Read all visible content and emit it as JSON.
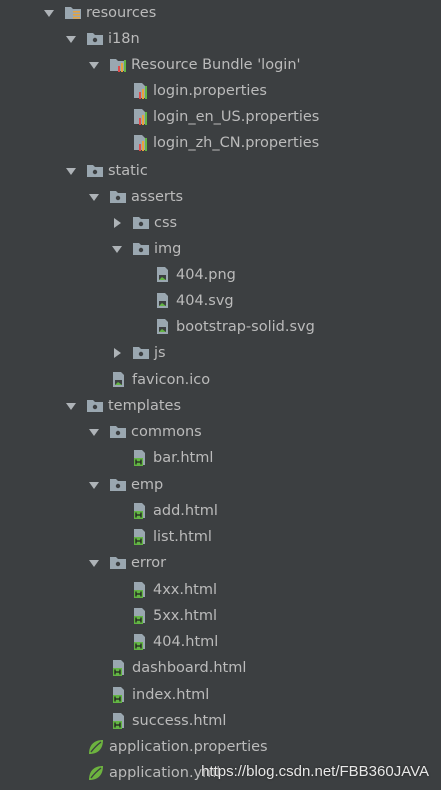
{
  "tree": [
    {
      "label": "resources",
      "icon": "resources-folder-icon",
      "expanded": true
    },
    {
      "label": "i18n",
      "icon": "folder-icon",
      "expanded": true
    },
    {
      "label": "Resource Bundle 'login'",
      "icon": "resource-bundle-icon",
      "expanded": true
    },
    {
      "label": "login.properties",
      "icon": "properties-file-icon"
    },
    {
      "label": "login_en_US.properties",
      "icon": "properties-file-icon"
    },
    {
      "label": "login_zh_CN.properties",
      "icon": "properties-file-icon"
    },
    {
      "label": "static",
      "icon": "folder-icon",
      "expanded": true
    },
    {
      "label": "asserts",
      "icon": "folder-icon",
      "expanded": true
    },
    {
      "label": "css",
      "icon": "folder-icon",
      "expanded": false
    },
    {
      "label": "img",
      "icon": "folder-icon",
      "expanded": true
    },
    {
      "label": "404.png",
      "icon": "image-file-icon"
    },
    {
      "label": "404.svg",
      "icon": "image-file-icon"
    },
    {
      "label": "bootstrap-solid.svg",
      "icon": "image-file-icon"
    },
    {
      "label": "js",
      "icon": "folder-icon",
      "expanded": false
    },
    {
      "label": "favicon.ico",
      "icon": "image-file-icon"
    },
    {
      "label": "templates",
      "icon": "folder-icon",
      "expanded": true
    },
    {
      "label": "commons",
      "icon": "folder-icon",
      "expanded": true
    },
    {
      "label": "bar.html",
      "icon": "html-file-icon"
    },
    {
      "label": "emp",
      "icon": "folder-icon",
      "expanded": true
    },
    {
      "label": "add.html",
      "icon": "html-file-icon"
    },
    {
      "label": "list.html",
      "icon": "html-file-icon"
    },
    {
      "label": "error",
      "icon": "folder-icon",
      "expanded": true
    },
    {
      "label": "4xx.html",
      "icon": "html-file-icon"
    },
    {
      "label": "5xx.html",
      "icon": "html-file-icon"
    },
    {
      "label": "404.html",
      "icon": "html-file-icon"
    },
    {
      "label": "dashboard.html",
      "icon": "html-file-icon"
    },
    {
      "label": "index.html",
      "icon": "html-file-icon"
    },
    {
      "label": "success.html",
      "icon": "html-file-icon"
    },
    {
      "label": "application.properties",
      "icon": "spring-leaf-icon"
    },
    {
      "label": "application.yml",
      "icon": "spring-leaf-icon"
    }
  ],
  "watermark": "https://blog.csdn.net/FBB360JAVA",
  "colors": {
    "background": "#3c3f41",
    "text": "#bbbbbb",
    "folder": "#9aa7b0",
    "html_green": "#62b543",
    "spring_green": "#6db33f"
  }
}
